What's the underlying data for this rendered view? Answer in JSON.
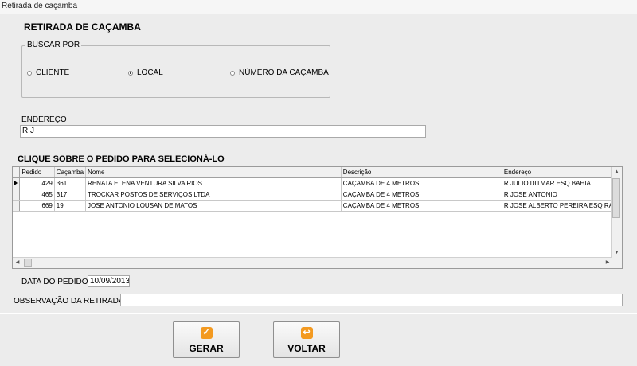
{
  "window": {
    "title": "Retirada de caçamba"
  },
  "heading": "RETIRADA DE CAÇAMBA",
  "search": {
    "legend": "BUSCAR POR",
    "options": [
      {
        "label": "CLIENTE",
        "selected": false
      },
      {
        "label": "LOCAL",
        "selected": true
      },
      {
        "label": "NÚMERO DA CAÇAMBA",
        "selected": false
      }
    ]
  },
  "address": {
    "label": "ENDEREÇO",
    "value": "R J"
  },
  "grid": {
    "instruction": "CLIQUE SOBRE O PEDIDO PARA SELECIONÁ-LO",
    "columns": [
      "Pedido",
      "Caçamba",
      "Nome",
      "Descrição",
      "Endereço"
    ],
    "rows": [
      [
        "429",
        "361",
        "RENATA ELENA VENTURA SILVA RIOS",
        "CAÇAMBA DE 4 METROS",
        "R JULIO DITMAR ESQ BAHIA"
      ],
      [
        "465",
        "317",
        "TROCKAR POSTOS DE SERVIÇOS LTDA",
        "CAÇAMBA DE 4 METROS",
        "R JOSE ANTONIO"
      ],
      [
        "669",
        "19",
        "JOSE ANTONIO LOUSAN DE MATOS",
        "CAÇAMBA DE 4 METROS",
        "R JOSE ALBERTO PEREIRA ESQ RACI"
      ]
    ],
    "current_row_index": 0
  },
  "order_date": {
    "label": "DATA DO PEDIDO",
    "value": "10/09/2013"
  },
  "observation": {
    "label": "OBSERVAÇÃO DA RETIRADA:",
    "value": ""
  },
  "buttons": {
    "generate": {
      "label": "GERAR",
      "icon": "check-icon"
    },
    "back": {
      "label": "VOLTAR",
      "icon": "undo-icon"
    }
  },
  "colors": {
    "button_icon": "#f39a21",
    "background": "#ececec"
  }
}
